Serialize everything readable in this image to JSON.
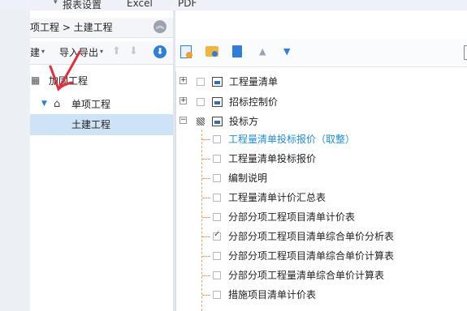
{
  "menu": {
    "items": [
      "报表设置",
      "Excel",
      "PDF"
    ]
  },
  "left": {
    "breadcrumb": "项工程 > 土建工程",
    "toolbar": {
      "new_label": "建",
      "import_export_label": "导入导出"
    },
    "tree": {
      "root": "加固工程",
      "child": "单项工程",
      "grandchild": "土建工程"
    }
  },
  "reports": {
    "items": [
      {
        "label": "工程量清单",
        "checked": false,
        "expander": "+"
      },
      {
        "label": "招标控制价",
        "checked": false,
        "expander": "+"
      },
      {
        "label": "投标方",
        "checked": "partial",
        "expander": "−"
      }
    ],
    "sub_items": [
      {
        "label": "工程量清单投标报价（取整）",
        "checked": false,
        "highlight": true
      },
      {
        "label": "工程量清单投标报价",
        "checked": false
      },
      {
        "label": "编制说明",
        "checked": false
      },
      {
        "label": "工程量清单计价汇总表",
        "checked": false
      },
      {
        "label": "分部分项工程项目清单计价表",
        "checked": false
      },
      {
        "label": "分部分项工程项目清单综合单价分析表",
        "checked": true
      },
      {
        "label": "分部分项工程项目清单综合单价计算表",
        "checked": false
      },
      {
        "label": "分部分项工程量清单综合单价计算表",
        "checked": false
      },
      {
        "label": "措施项目清单计价表",
        "checked": false
      }
    ]
  },
  "colors": {
    "accent": "#2f7fd8",
    "selected_bg": "#cfe3f7",
    "highlight_text": "#1d8ed8",
    "tree_line": "#f0a060",
    "annotation": "#e0303c"
  }
}
